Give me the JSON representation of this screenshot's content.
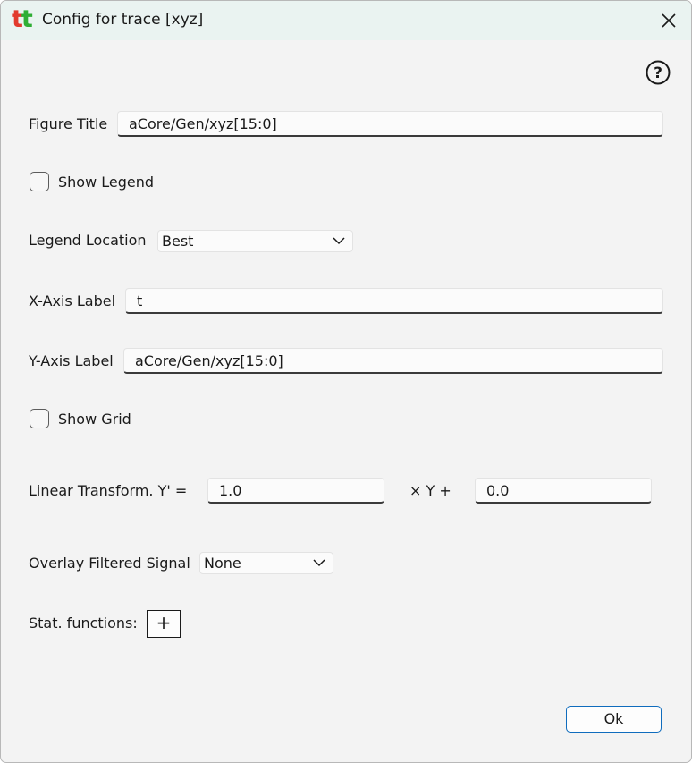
{
  "window": {
    "title": "Config for trace [xyz]",
    "logo_text_1": "t",
    "logo_text_2": "t"
  },
  "fields": {
    "figure_title": {
      "label": "Figure Title",
      "value": "aCore/Gen/xyz[15:0]"
    },
    "show_legend": {
      "label": "Show Legend",
      "checked": false
    },
    "legend_location": {
      "label": "Legend Location",
      "value": "Best"
    },
    "x_axis_label": {
      "label": "X-Axis Label",
      "value": "t"
    },
    "y_axis_label": {
      "label": "Y-Axis Label",
      "value": "aCore/Gen/xyz[15:0]"
    },
    "show_grid": {
      "label": "Show Grid",
      "checked": false
    },
    "linear_transform": {
      "label": "Linear Transform. Y' =",
      "scale": "1.0",
      "times_y_plus": "× Y +",
      "offset": "0.0"
    },
    "overlay_filtered_signal": {
      "label": "Overlay Filtered Signal",
      "value": "None"
    },
    "stat_functions": {
      "label": "Stat. functions:",
      "add_label": "+"
    }
  },
  "buttons": {
    "ok": "Ok"
  },
  "icons": {
    "close": "close-icon",
    "help": "help-icon",
    "dropdown": "chevron-down-icon"
  }
}
